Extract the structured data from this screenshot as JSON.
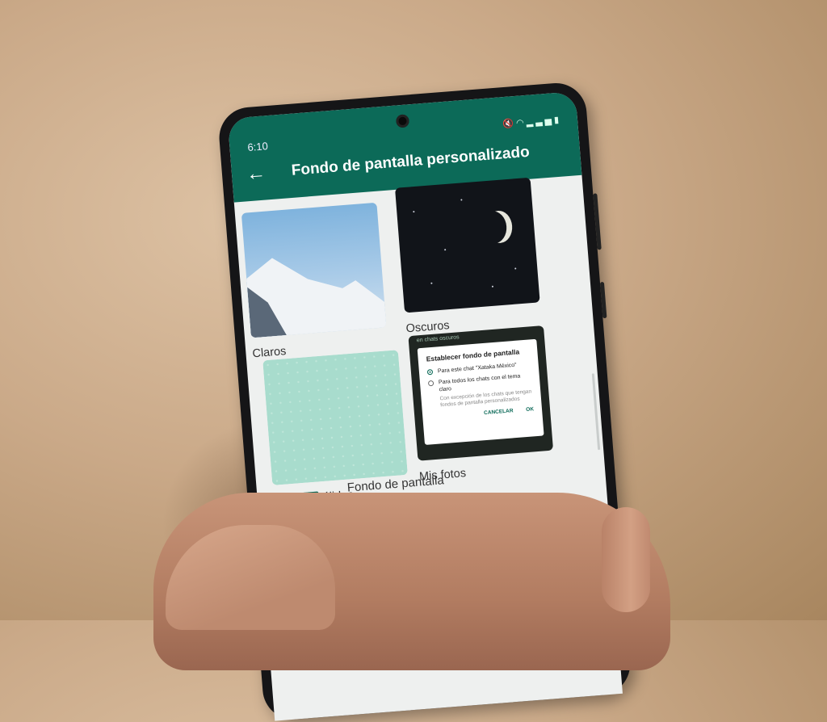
{
  "status_bar": {
    "time": "6:10",
    "icons": [
      "mute-icon",
      "wifi-icon",
      "signal-icon",
      "battery-icon"
    ]
  },
  "app_bar": {
    "title": "Fondo de pantalla personalizado",
    "back_icon": "arrow-left-icon"
  },
  "categories": [
    {
      "label": "Claros"
    },
    {
      "label": "Oscuros"
    },
    {
      "label": "Colores sólidos"
    },
    {
      "label": "Mis fotos"
    }
  ],
  "dialog_preview": {
    "top_strip": "en chats oscuros",
    "title": "Establecer fondo de pantalla",
    "option_1": "Para este chat \"Xataka México\"",
    "option_2": "Para todos los chats con el tema claro",
    "option_2_note": "Con excepción de los chats que tengan fondos de pantalla personalizados",
    "cancel": "CANCELAR",
    "ok": "OK"
  },
  "default_wallpaper": {
    "label": "Fondo de pantalla predeterminado",
    "icon": "image-icon"
  },
  "colors": {
    "header": "#0c6a58",
    "screen_bg": "#eef0ef"
  }
}
